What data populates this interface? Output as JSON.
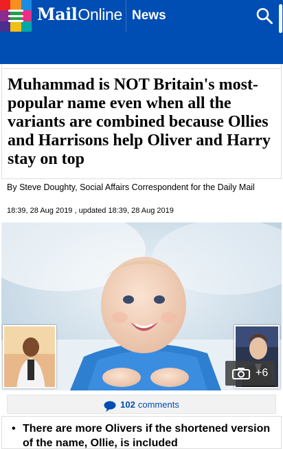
{
  "header": {
    "logo_mail": "Mail",
    "logo_online": "Online",
    "section": "News",
    "menu_colors": [
      "#ed2124",
      "#f58f1f",
      "#1b8de0",
      "#8b2b8e",
      "#21a14b",
      "#ec2f82",
      "#4b2f8e",
      "#f0c017",
      "#00a8a8"
    ],
    "brand_color": "#004db3"
  },
  "article": {
    "headline": "Muhammad is NOT Britain's most-popular name even when all the variants are combined because Ollies and Harrisons help Oliver and Harry stay on top",
    "byline_prefix": "By ",
    "author": "Steve Doughty",
    "author_role": ", Social Affairs Correspondent for the Daily Mail",
    "published": "18:39, 28 Aug 2019",
    "updated_label": " , updated ",
    "updated": "18:39, 28 Aug 2019"
  },
  "gallery": {
    "photo_count": "+6"
  },
  "comments": {
    "count": "102",
    "label": "comments"
  },
  "bullets": [
    "There are more Olivers if the shortened version of the name, Ollie, is included"
  ]
}
